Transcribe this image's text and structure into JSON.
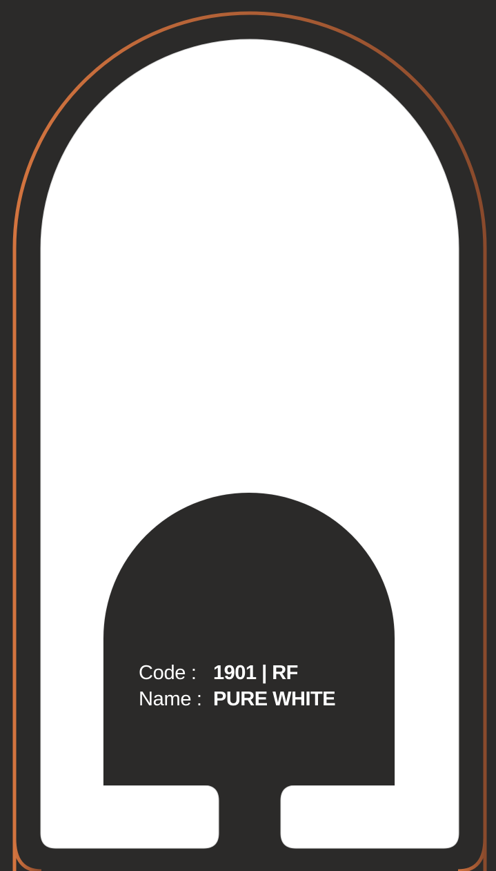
{
  "colors": {
    "background": "#2b2a29",
    "swatch": "#ffffff",
    "frame_gradient_start": "#d3743f",
    "frame_gradient_end": "#8a4a2c",
    "label_panel": "#2b2a29"
  },
  "swatch": {
    "code_label": "Code  :",
    "code_value": "1901 | RF",
    "name_label": "Name :",
    "name_value": "PURE WHITE"
  }
}
